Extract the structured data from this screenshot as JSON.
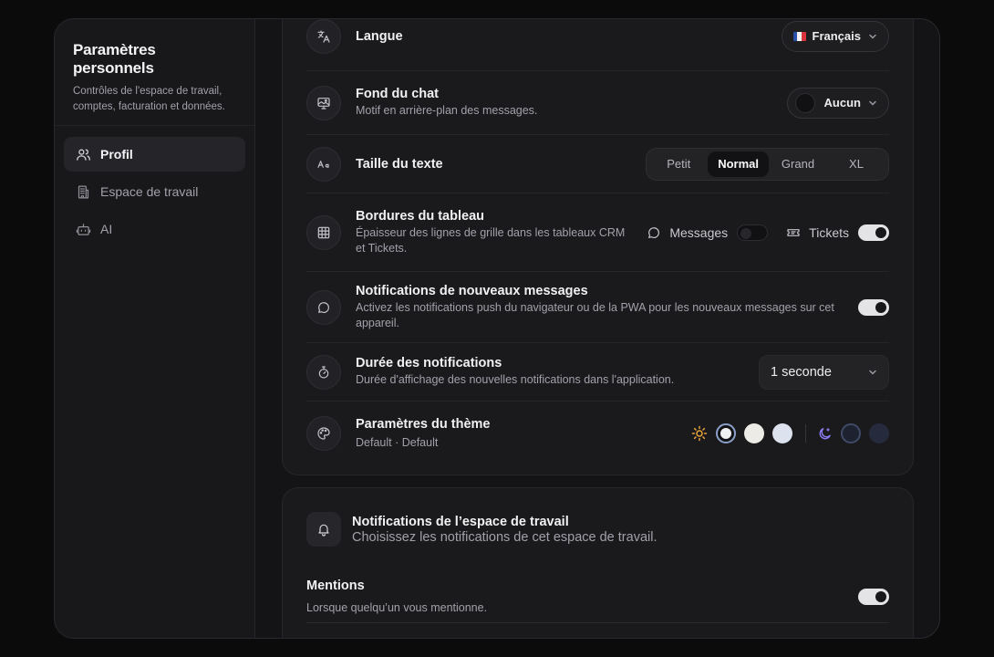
{
  "sidebar": {
    "title": "Paramètres personnels",
    "subtitle": "Contrôles de l'espace de travail, comptes, facturation et données.",
    "items": [
      {
        "label": "Profil",
        "icon": "users-icon",
        "active": true
      },
      {
        "label": "Espace de travail",
        "icon": "building-icon",
        "active": false
      },
      {
        "label": "AI",
        "icon": "bot-icon",
        "active": false
      }
    ]
  },
  "settings": {
    "language": {
      "title": "Langue",
      "value": "Français",
      "icon": "translate-icon"
    },
    "chat_background": {
      "title": "Fond du chat",
      "desc": "Motif en arrière-plan des messages.",
      "value": "Aucun",
      "icon": "image-icon"
    },
    "text_size": {
      "title": "Taille du texte",
      "options": [
        "Petit",
        "Normal",
        "Grand",
        "XL"
      ],
      "selected": "Normal",
      "icon": "text-size-icon"
    },
    "table_borders": {
      "title": "Bordures du tableau",
      "desc": "Épaisseur des lignes de grille dans les tableaux CRM et Tickets.",
      "messages_label": "Messages",
      "messages_on": false,
      "tickets_label": "Tickets",
      "tickets_on": true,
      "icon": "table-icon"
    },
    "new_message_notifications": {
      "title": "Notifications de nouveaux messages",
      "desc": "Activez les notifications push du navigateur ou de la PWA pour les nouveaux messages sur cet appareil.",
      "on": true,
      "icon": "chat-bubble-icon"
    },
    "notification_duration": {
      "title": "Durée des notifications",
      "desc": "Durée d'affichage des nouvelles notifications dans l'application.",
      "value": "1 seconde",
      "icon": "stopwatch-icon"
    },
    "theme": {
      "title": "Paramètres du thème",
      "desc": "Default · Default",
      "icon": "palette-icon",
      "light_swatches": [
        "#f0f0f2",
        "#ecebe6",
        "#dde3ee"
      ],
      "dark_swatches": [
        "#1d2130",
        "#252a3d"
      ]
    }
  },
  "workspace_notifications": {
    "title": "Notifications de l’espace de travail",
    "subtitle": "Choisissez les notifications de cet espace de travail.",
    "mentions": {
      "title": "Mentions",
      "desc": "Lorsque quelqu’un vous mentionne.",
      "on": true
    }
  },
  "colors": {
    "accent_sun": "#e8a23a",
    "accent_moon": "#8a7cf0"
  }
}
